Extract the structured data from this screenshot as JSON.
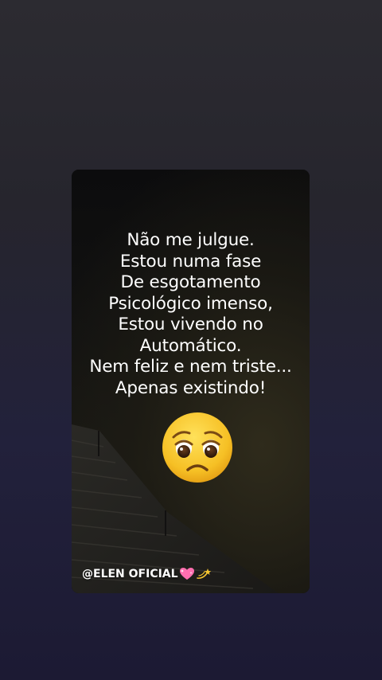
{
  "post": {
    "quote_lines": [
      "Não me julgue.",
      "Estou numa fase",
      "De esgotamento",
      "Psicológico imenso,",
      "Estou vivendo no",
      "Automático.",
      "Nem feliz e nem triste...",
      "Apenas existindo!"
    ],
    "emoji_icon": "pleading-sad-face-icon",
    "handle": "@ELEN OFICIAL",
    "handle_icons": [
      "sparkling-heart-icon",
      "dizzy-star-icon"
    ]
  },
  "colors": {
    "background": "#26252d",
    "card": "#0d0c0b",
    "text": "#ffffff",
    "emoji_face": "#f6c025",
    "heart": "#ff6fb0",
    "dizzy": "#f4c430"
  }
}
